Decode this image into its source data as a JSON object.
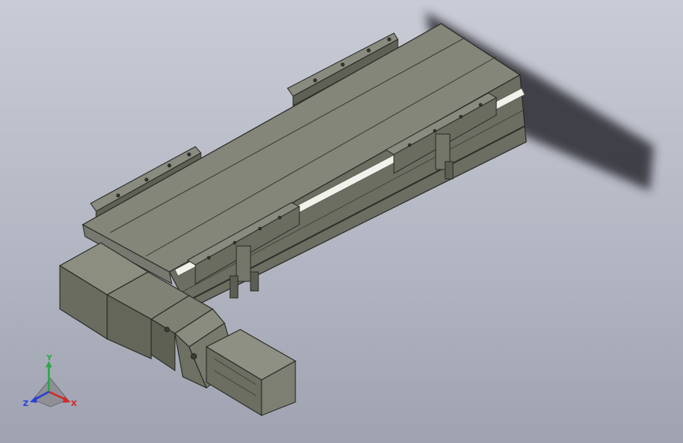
{
  "viewport": {
    "background_top": "#c9ccd6",
    "background_bottom": "#9fa3b1",
    "model_color": "#7d7f72",
    "rail_color": "#f2f2ec"
  },
  "triad": {
    "y_label": "Y",
    "x_label": "X",
    "z_label": "Z",
    "y_color": "#2aa845",
    "x_color": "#d42a2a",
    "z_color": "#2a3fd4"
  }
}
